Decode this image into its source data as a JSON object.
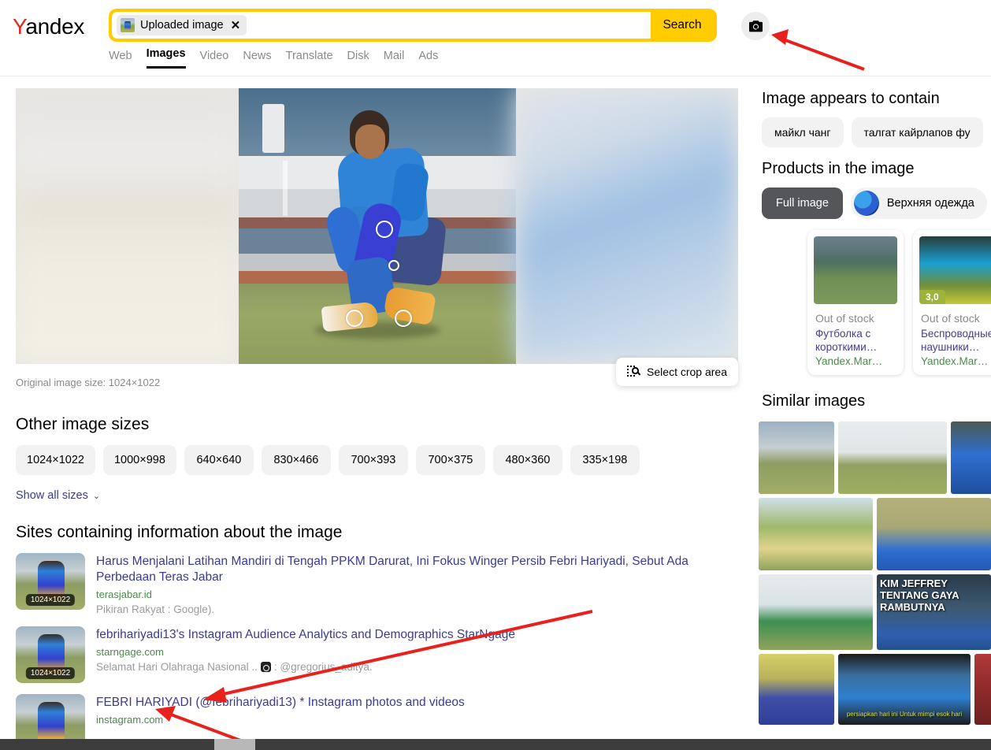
{
  "header": {
    "logo": "Yandex",
    "logo_first_letter": "Y",
    "logo_rest": "andex",
    "search": {
      "chip_label": "Uploaded image",
      "chip_close": "✕",
      "chip_thumb_icon": "uploaded-image-thumbnail",
      "search_button": "Search",
      "camera_icon": "camera-search-icon"
    },
    "tabs": [
      {
        "label": "Web",
        "active": false
      },
      {
        "label": "Images",
        "active": true
      },
      {
        "label": "Video",
        "active": false
      },
      {
        "label": "News",
        "active": false
      },
      {
        "label": "Translate",
        "active": false
      },
      {
        "label": "Disk",
        "active": false
      },
      {
        "label": "Mail",
        "active": false
      },
      {
        "label": "Ads",
        "active": false
      }
    ]
  },
  "left": {
    "original_size_label": "Original image size: 1024×1022",
    "crop_button": {
      "label": "Select crop area",
      "icon": "crop-search-icon"
    },
    "other_sizes_title": "Other image sizes",
    "sizes": [
      "1024×1022",
      "1000×998",
      "640×640",
      "830×466",
      "700×393",
      "700×375",
      "480×360",
      "335×198"
    ],
    "show_all_sizes": "Show all sizes",
    "show_all_chevron": "⌄",
    "sites_title": "Sites containing information about the image",
    "sites": [
      {
        "title": "Harus Menjalani Latihan Mandiri di Tengah PPKM Darurat, Ini Fokus Winger Persib Febri Hariyadi, Sebut Ada Perbedaan Teras Jabar",
        "host": "terasjabar.id",
        "desc": "Pikiran Rakyat : Google).",
        "size_badge": "1024×1022",
        "has_ig_glyph": false
      },
      {
        "title": "febrihariyadi13's Instagram Audience Analytics and Demographics StarNgage",
        "host": "starngage.com",
        "desc_before": "Selamat Hari Olahraga Nasional ..",
        "desc_after": ": @gregorius_aditya.",
        "size_badge": "1024×1022",
        "has_ig_glyph": true
      },
      {
        "title": "FEBRI HARIYADI (@febrihariyadi13) * Instagram photos and videos",
        "host": "instagram.com",
        "desc": "",
        "size_badge": "",
        "has_ig_glyph": false
      }
    ]
  },
  "right": {
    "contains_title": "Image appears to contain",
    "contains_chips": [
      "майкл чанг",
      "талгат кайрлапов фу"
    ],
    "products_title": "Products in the image",
    "full_image_chip": "Full image",
    "product_filter_chip": "Верхняя одежда",
    "products": [
      {
        "stock": "Out of stock",
        "name": "Футболка с короткими…",
        "source": "Yandex.Mar…",
        "rating": ""
      },
      {
        "stock": "Out of stock",
        "name": "Беспроводные наушники…",
        "source": "Yandex.Mar…",
        "rating": "3,0"
      }
    ],
    "similar_title": "Similar images",
    "similar_captions": {
      "kim_jeffrey": "KIM JEFFREY TENTANG GAYA RAMBUTNYA",
      "subtitle": "persiapkan hari ini Untuk mimpi esok hari"
    }
  },
  "annotations": {
    "arrow_color": "#e8211c",
    "arrow_count": 3
  },
  "colors": {
    "brand_yellow": "#ffcc00",
    "logo_red": "#e12a1f",
    "link_blue": "#3b3b8f",
    "host_green": "#4a8a4a",
    "muted_gray": "#8a8a8a",
    "chip_gray": "#f2f2f2",
    "dark_chip": "#55565a",
    "rating_green": "#9bb43c"
  }
}
